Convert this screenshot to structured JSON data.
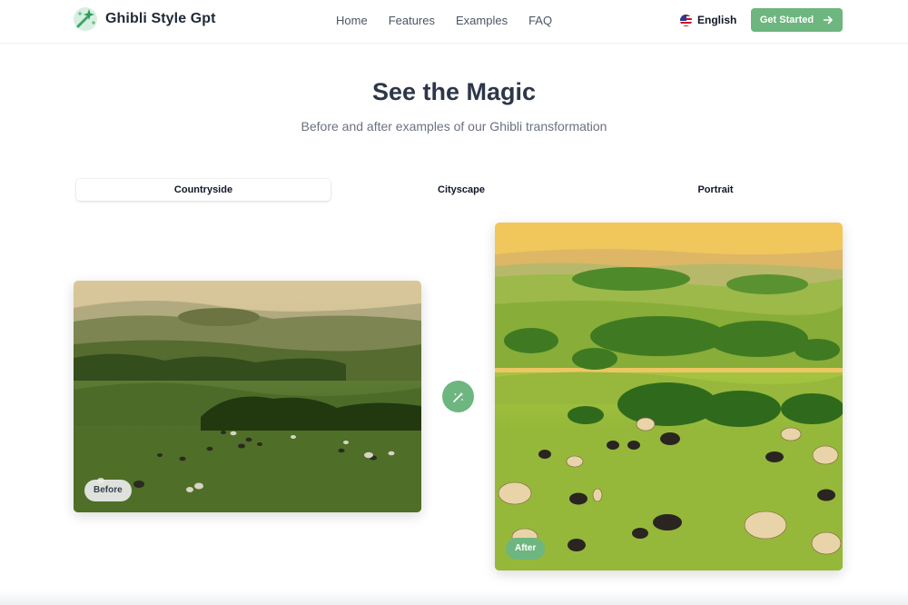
{
  "header": {
    "brand": "Ghibli Style Gpt",
    "nav": [
      "Home",
      "Features",
      "Examples",
      "FAQ"
    ],
    "language": "English",
    "cta_label": "Get Started"
  },
  "hero": {
    "title": "See the Magic",
    "subtitle": "Before and after examples of our Ghibli transformation"
  },
  "tabs": {
    "items": [
      "Countryside",
      "Cityscape",
      "Portrait"
    ],
    "active": "Countryside"
  },
  "comparison": {
    "before_label": "Before",
    "after_label": "After"
  },
  "colors": {
    "accent": "#6db67f",
    "title": "#2d3748",
    "muted": "#6b7280"
  },
  "icons": {
    "logo": "magic-wand-sparkle-icon",
    "flag": "us-flag-icon",
    "cta": "arrow-right-icon",
    "transform": "magic-wand-icon"
  }
}
